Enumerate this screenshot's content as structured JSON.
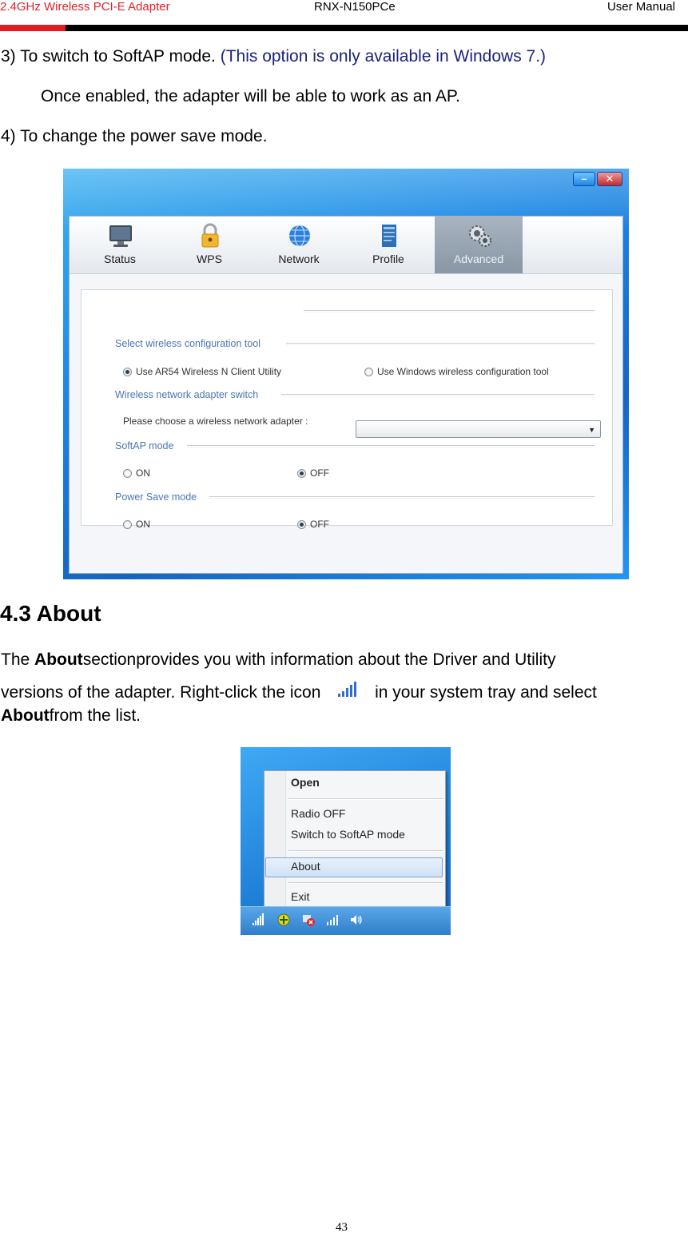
{
  "header": {
    "product": "2.4GHz Wireless PCI-E Adapter",
    "model": "RNX-N150PCe",
    "doc_type": "User Manual"
  },
  "body": {
    "item3_text": "3) To switch to SoftAP mode.",
    "item3_note": "(This option is only available in Windows 7.)",
    "item3_detail": "Once enabled, the adapter will be able to work as an AP.",
    "item4_text": "4) To change the power save mode."
  },
  "utility_window": {
    "tabs": [
      {
        "label": "Status"
      },
      {
        "label": "WPS"
      },
      {
        "label": "Network"
      },
      {
        "label": "Profile"
      },
      {
        "label": "Advanced"
      }
    ],
    "active_tab": "Advanced",
    "sections": {
      "config_tool": "Select wireless configuration tool",
      "config_opt1": "Use AR54 Wireless N Client Utility",
      "config_opt2": "Use Windows wireless configuration tool",
      "adapter_switch": "Wireless network adapter switch",
      "adapter_prompt": "Please choose a wireless network adapter :",
      "softap": "SoftAP mode",
      "softap_on": "ON",
      "softap_off": "OFF",
      "powersave": "Power Save mode",
      "powersave_on": "ON",
      "powersave_off": "OFF"
    }
  },
  "about_section": {
    "heading": "4.3 About",
    "p1_prefix": "The",
    "p1_bold": "About",
    "p1_rest": "sectionprovides you with information about the Driver and Utility",
    "p2_start": "versions of the adapter. Right-click the icon",
    "p2_end": "in your system tray and select",
    "p3_bold": "About",
    "p3_rest": "from the list."
  },
  "tray_menu": {
    "items": [
      "Open",
      "Radio OFF",
      "Switch to SoftAP mode",
      "About",
      "Exit"
    ],
    "highlighted": "About"
  },
  "footer": {
    "page_number": "43"
  }
}
